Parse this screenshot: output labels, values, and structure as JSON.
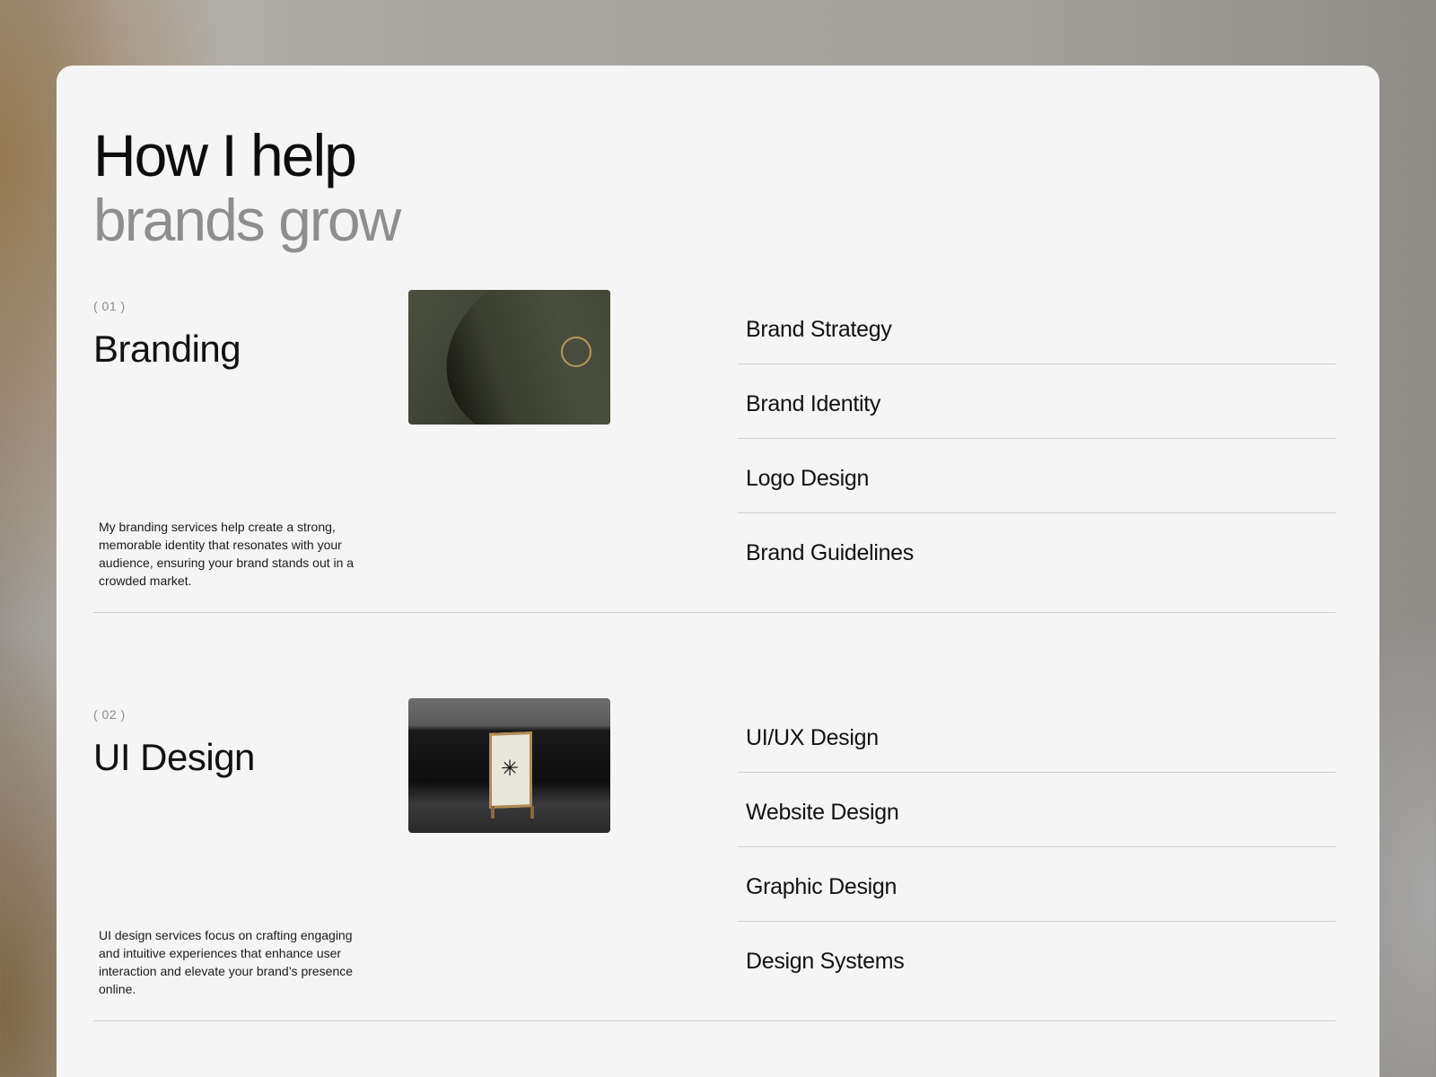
{
  "headline": {
    "line1": "How I help",
    "line2": "brands grow"
  },
  "services": [
    {
      "number": "( 01 )",
      "title": "Branding",
      "description": "My branding services help create a strong, memorable identity that resonates with your audience, ensuring your brand stands out in a crowded market.",
      "items": [
        "Brand Strategy",
        "Brand Identity",
        "Logo Design",
        "Brand Guidelines"
      ]
    },
    {
      "number": "( 02 )",
      "title": "UI Design",
      "description": "UI design services focus on crafting engaging and intuitive experiences that enhance user interaction and elevate your brand’s presence online.",
      "items": [
        "UI/UX Design",
        "Website Design",
        "Graphic Design",
        "Design Systems"
      ]
    }
  ],
  "colors": {
    "card_bg": "#f5f5f5",
    "headline_dark": "#0d0d0d",
    "headline_muted": "#8e8e8e",
    "divider": "#cfcfcf"
  }
}
